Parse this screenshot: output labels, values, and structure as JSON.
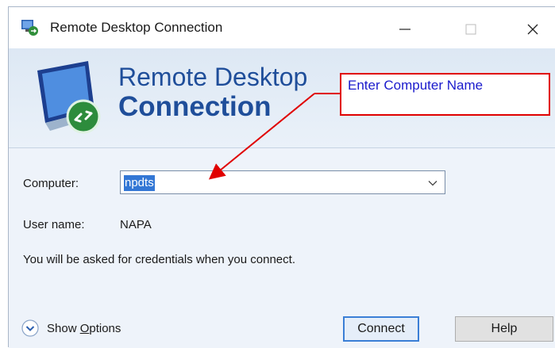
{
  "window": {
    "title": "Remote Desktop Connection"
  },
  "banner": {
    "line1": "Remote Desktop",
    "line2": "Connection"
  },
  "form": {
    "computer_label": "Computer:",
    "computer_value": "npdts",
    "username_label": "User name:",
    "username_value": "NAPA",
    "info_text": "You will be asked for credentials when you connect."
  },
  "options": {
    "label_prefix": "Show ",
    "label_accel": "O",
    "label_suffix": "ptions"
  },
  "buttons": {
    "connect": "Connect",
    "help": "Help"
  },
  "annotation": {
    "text": "Enter Computer Name"
  },
  "colors": {
    "accent_blue": "#1f4e9a",
    "selection": "#3377d5",
    "callout_border": "#e00000",
    "callout_text": "#1a1acc"
  },
  "icons": {
    "app": "remote-desktop-icon",
    "minimize": "minimize-icon",
    "maximize": "maximize-icon",
    "close": "close-icon",
    "banner": "monitor-connection-icon",
    "dropdown": "chevron-down-icon",
    "options": "expand-circle-icon"
  }
}
